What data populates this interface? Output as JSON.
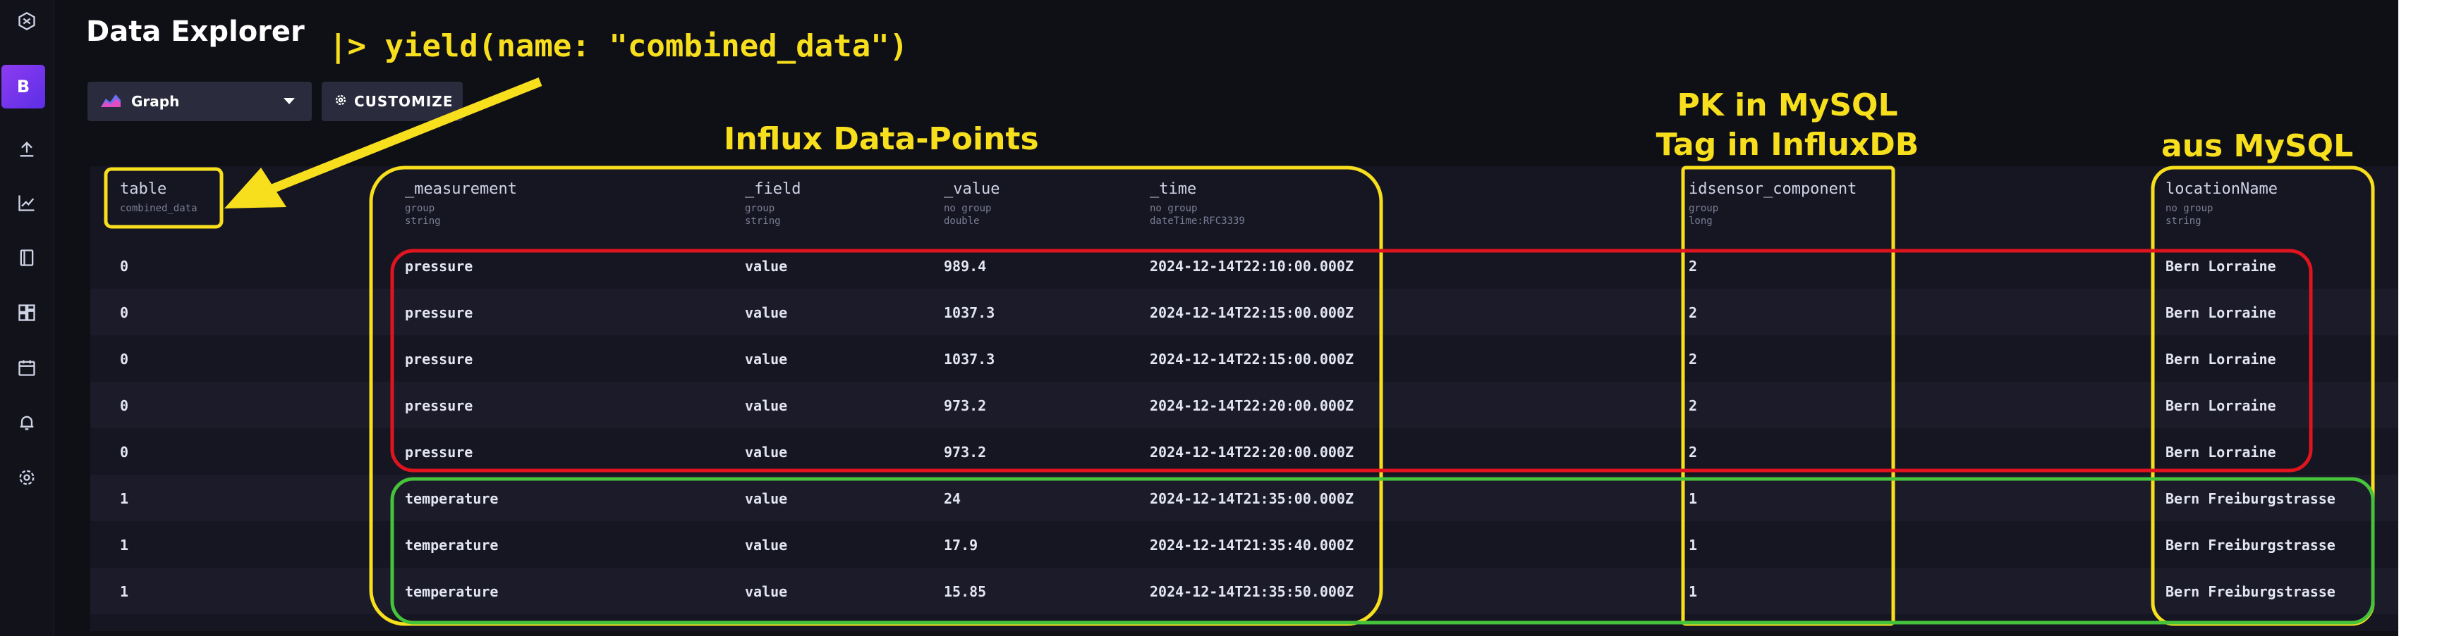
{
  "page_title": "Data Explorer",
  "user_initial": "B",
  "toolbar": {
    "graph_label": "Graph",
    "customize_label": "CUSTOMIZE"
  },
  "columns": [
    {
      "name": "table",
      "sub1": "combined_data",
      "sub2": ""
    },
    {
      "name": "_measurement",
      "sub1": "group",
      "sub2": "string"
    },
    {
      "name": "_field",
      "sub1": "group",
      "sub2": "string"
    },
    {
      "name": "_value",
      "sub1": "no group",
      "sub2": "double"
    },
    {
      "name": "_time",
      "sub1": "no group",
      "sub2": "dateTime:RFC3339"
    },
    {
      "name": "idsensor_component",
      "sub1": "group",
      "sub2": "long"
    },
    {
      "name": "locationName",
      "sub1": "no group",
      "sub2": "string"
    }
  ],
  "rows": [
    [
      "0",
      "pressure",
      "value",
      "989.4",
      "2024-12-14T22:10:00.000Z",
      "2",
      "Bern Lorraine"
    ],
    [
      "0",
      "pressure",
      "value",
      "1037.3",
      "2024-12-14T22:15:00.000Z",
      "2",
      "Bern Lorraine"
    ],
    [
      "0",
      "pressure",
      "value",
      "1037.3",
      "2024-12-14T22:15:00.000Z",
      "2",
      "Bern Lorraine"
    ],
    [
      "0",
      "pressure",
      "value",
      "973.2",
      "2024-12-14T22:20:00.000Z",
      "2",
      "Bern Lorraine"
    ],
    [
      "0",
      "pressure",
      "value",
      "973.2",
      "2024-12-14T22:20:00.000Z",
      "2",
      "Bern Lorraine"
    ],
    [
      "1",
      "temperature",
      "value",
      "24",
      "2024-12-14T21:35:00.000Z",
      "1",
      "Bern Freiburgstrasse"
    ],
    [
      "1",
      "temperature",
      "value",
      "17.9",
      "2024-12-14T21:35:40.000Z",
      "1",
      "Bern Freiburgstrasse"
    ],
    [
      "1",
      "temperature",
      "value",
      "15.85",
      "2024-12-14T21:35:50.000Z",
      "1",
      "Bern Freiburgstrasse"
    ]
  ],
  "annotations": {
    "yield_code": "|> yield(name: \"combined_data\")",
    "influx_points": "Influx Data-Points",
    "pk_line1": "PK in MySQL",
    "pk_line2": "Tag in InfluxDB",
    "aus_mysql": "aus MySQL"
  },
  "colors": {
    "annotation_yellow": "#f7df1e",
    "highlight_red": "#e0141e",
    "highlight_green": "#46c23b",
    "background": "#0f0f16"
  },
  "icons": {
    "logo": "influx-logo-icon",
    "upload": "upload-icon",
    "explore": "chart-icon",
    "notebooks": "notebook-icon",
    "dashboards": "dashboards-icon",
    "tasks": "calendar-icon",
    "alerts": "bell-icon",
    "settings": "gear-icon",
    "graph": "graph-icon",
    "customize": "gear-icon",
    "dropdown": "caret-down-icon"
  }
}
